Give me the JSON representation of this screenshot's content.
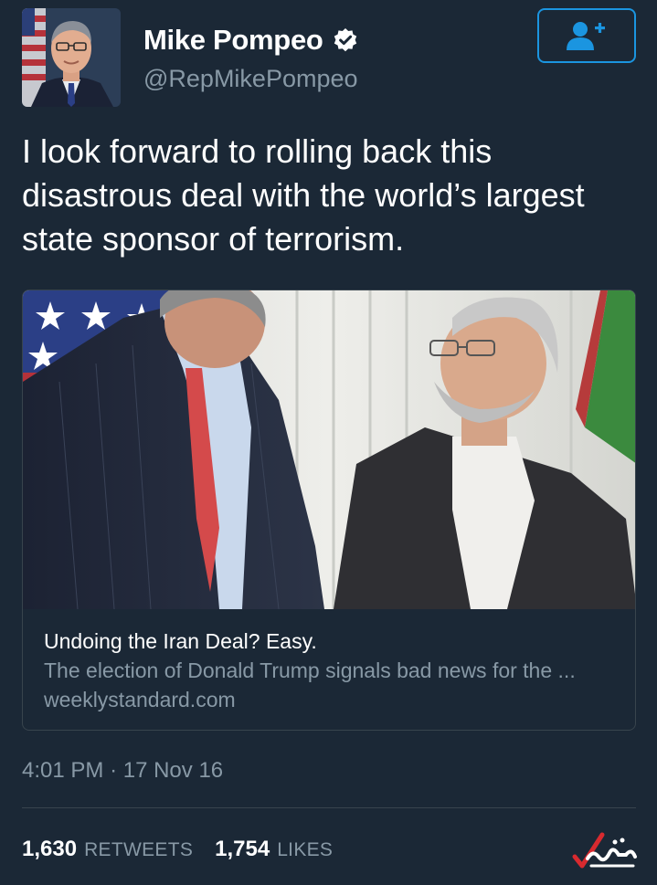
{
  "author": {
    "name": "Mike Pompeo",
    "handle": "@RepMikePompeo",
    "verified": true,
    "avatar_icon": "profile-photo"
  },
  "follow_button": {
    "icon": "add-user-icon"
  },
  "tweet": {
    "text_lines": [
      "I look forward to rolling back this",
      "disastrous deal with the world’s largest",
      "state sponsor of terrorism."
    ]
  },
  "card": {
    "title": "Undoing the Iran Deal? Easy.",
    "description": "The election of Donald Trump signals bad news for the ...",
    "domain": "weeklystandard.com"
  },
  "meta": {
    "time": "4:01 PM",
    "separator": "·",
    "date": "17 Nov 16"
  },
  "stats": {
    "retweets_count": "1,630",
    "retweets_label": "RETWEETS",
    "likes_count": "1,754",
    "likes_label": "LIKES"
  },
  "colors": {
    "background": "#1b2836",
    "accent": "#1b95e0",
    "secondary_text": "#8899a6",
    "border": "#38444d"
  }
}
